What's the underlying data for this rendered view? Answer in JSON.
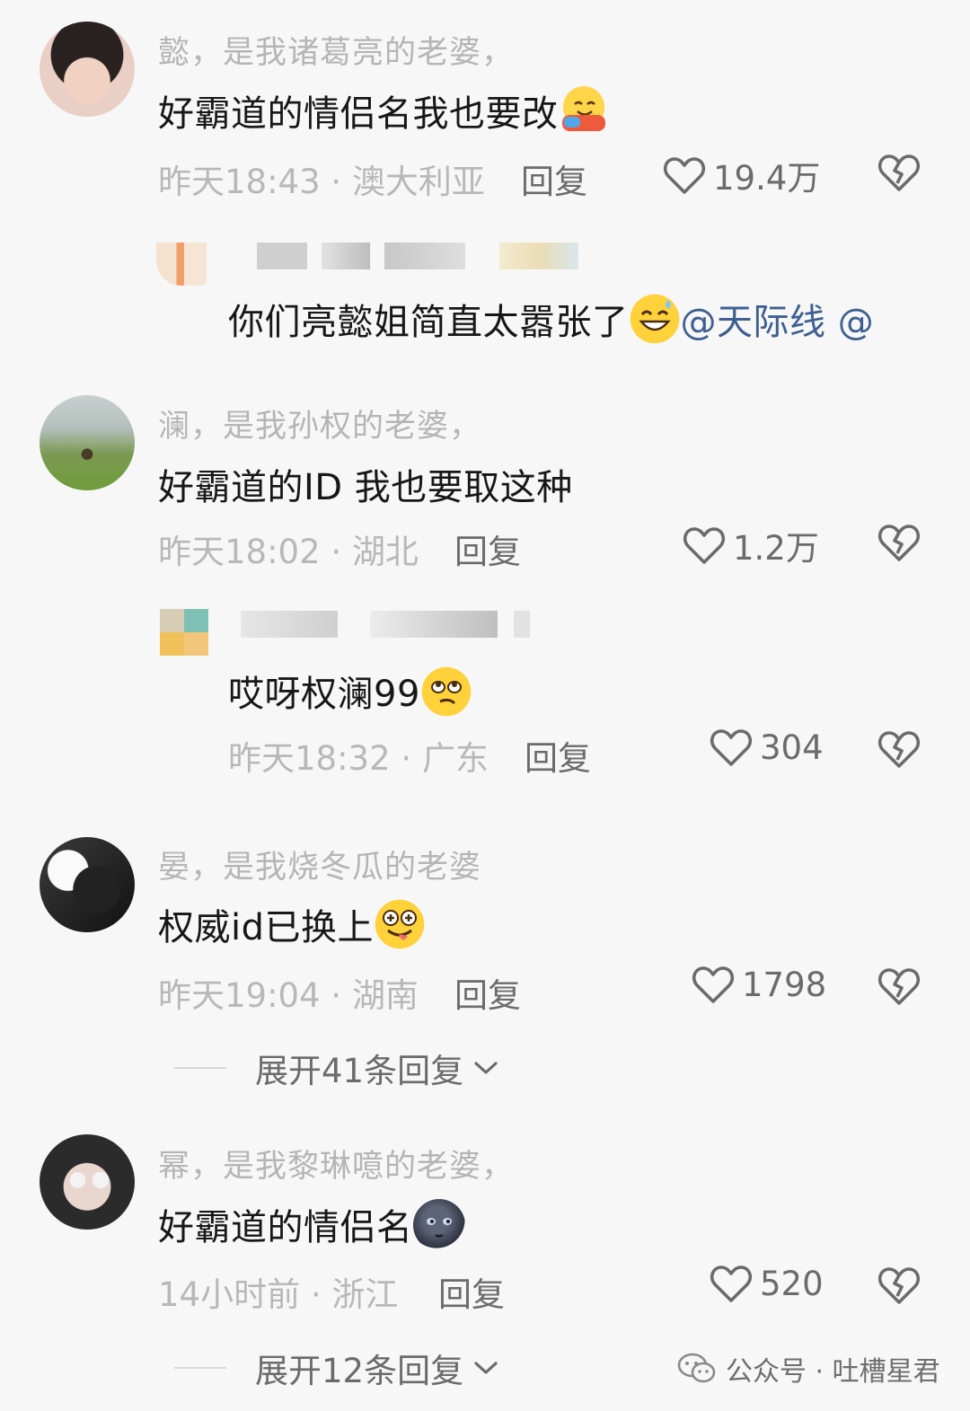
{
  "comments": [
    {
      "name": "懿，是我诸葛亮的老婆，",
      "text": "好霸道的情侣名我也要改",
      "emoji": "hugging-face-emoji",
      "time": "昨天18:43",
      "location": "澳大利亚",
      "reply": "回复",
      "likes": "19.4万",
      "replies": [
        {
          "text": "你们亮懿姐简直太嚣张了",
          "emoji": "grinning-sweat-emoji",
          "mention": "@天际线 @"
        }
      ]
    },
    {
      "name": "澜，是我孙权的老婆，",
      "text": "好霸道的ID 我也要取这种",
      "time": "昨天18:02",
      "location": "湖北",
      "reply": "回复",
      "likes": "1.2万",
      "replies": [
        {
          "text": "哎呀权澜99",
          "emoji": "eye-roll-emoji",
          "time": "昨天18:32",
          "location": "广东",
          "reply": "回复",
          "likes": "304"
        }
      ]
    },
    {
      "name": "晏，是我烧冬瓜的老婆",
      "text": "权威id已换上",
      "emoji": "zany-face-emoji",
      "time": "昨天19:04",
      "location": "湖南",
      "reply": "回复",
      "likes": "1798",
      "expand": "展开41条回复"
    },
    {
      "name": "幂，是我黎琳噫的老婆，",
      "text": "好霸道的情侣名",
      "emoji": "new-moon-face-emoji",
      "time": "14小时前",
      "location": "浙江",
      "reply": "回复",
      "likes": "520",
      "expand": "展开12条回复"
    }
  ],
  "separator": "·",
  "watermark": "公众号 · 吐槽星君",
  "icons": [
    "heart-icon",
    "broken-heart-icon",
    "chevron-down-icon",
    "wechat-icon"
  ],
  "colors": {
    "mention": "#3e5f8f",
    "meta": "#b8b8b8",
    "text": "#171717"
  }
}
